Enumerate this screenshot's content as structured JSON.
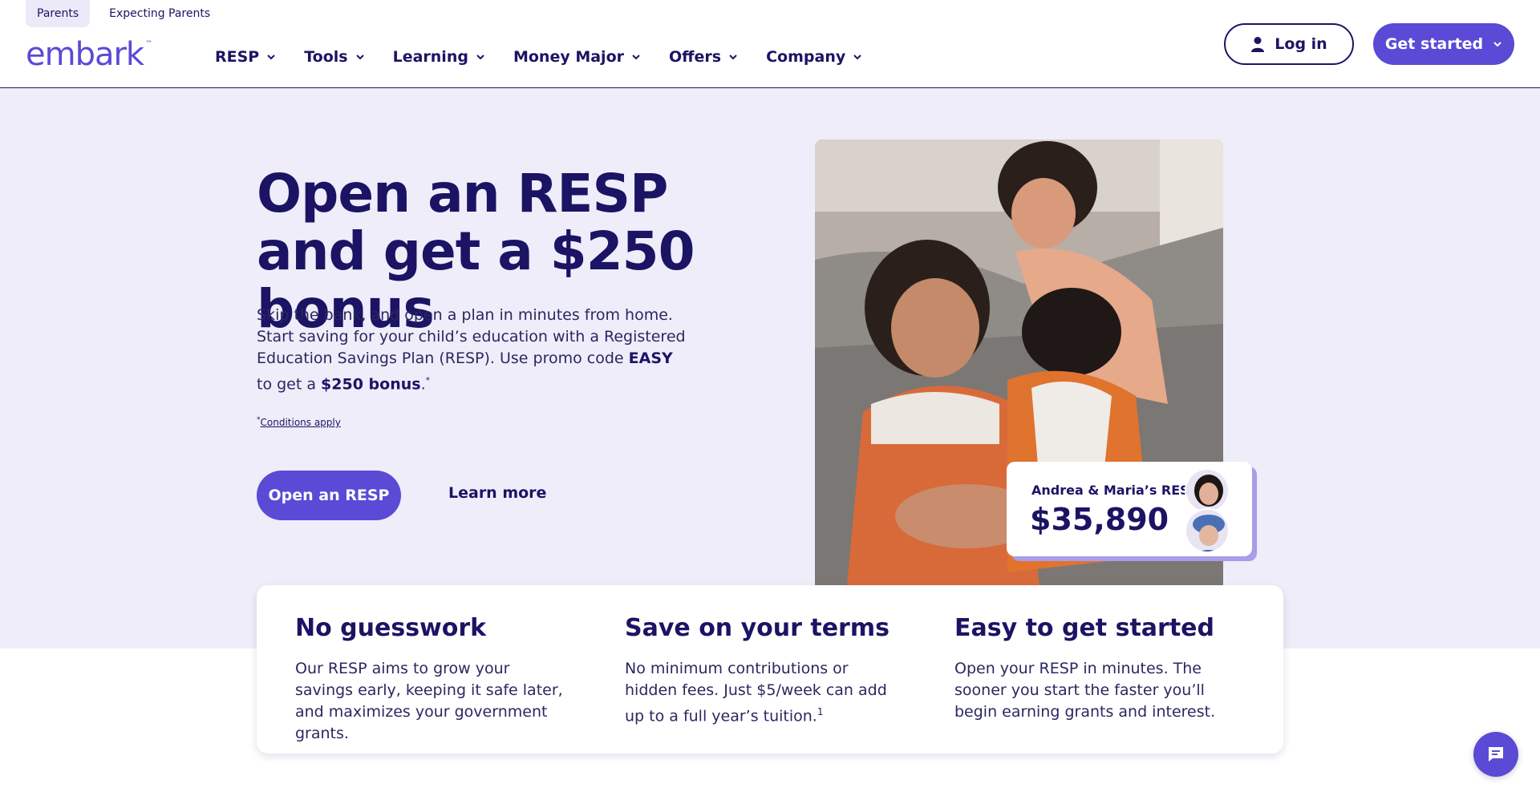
{
  "audience_tabs": [
    {
      "label": "Parents",
      "active": true
    },
    {
      "label": "Expecting Parents",
      "active": false
    }
  ],
  "brand": {
    "logo_text": "embark",
    "trademark": "™",
    "accent": "#5a4ad6",
    "navy": "#1b1464"
  },
  "nav": {
    "items": [
      "RESP",
      "Tools",
      "Learning",
      "Money Major",
      "Offers",
      "Company"
    ],
    "login_label": "Log in",
    "get_started_label": "Get started"
  },
  "hero": {
    "title": "Open an RESP and get a $250 bonus",
    "lead_part1": "Skip the bank, and open a plan in minutes from home. Start saving for your child’s education with a Registered Education Savings Plan (RESP). Use promo code ",
    "promo_code": "EASY",
    "lead_part2": " to get a ",
    "bonus": "$250 bonus",
    "lead_end": ".",
    "footnote_mark": "*",
    "conditions": "Conditions apply",
    "primary_cta": "Open an RESP",
    "secondary_cta": "Learn more"
  },
  "balance_card": {
    "name": "Andrea & Maria’s RESP",
    "amount": "$35,890"
  },
  "features": [
    {
      "title": "No guesswork",
      "text": "Our RESP aims to grow your savings early, keeping it safe later, and maximizes your government grants.",
      "sup": ""
    },
    {
      "title": "Save on your terms",
      "text": "No minimum contributions or hidden fees. Just $5/week can add up to a full year’s tuition.",
      "sup": "1"
    },
    {
      "title": "Easy to get started",
      "text": "Open your RESP in minutes. The sooner you start the faster you’ll begin earning grants and interest.",
      "sup": ""
    }
  ]
}
